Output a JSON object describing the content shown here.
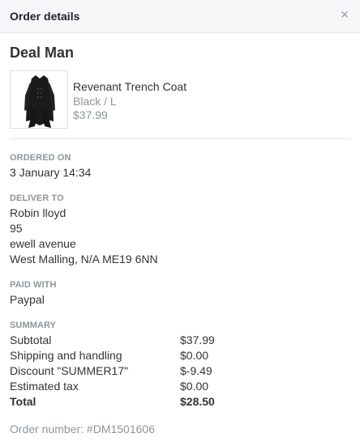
{
  "header": {
    "title": "Order details",
    "close_glyph": "×"
  },
  "merchant": "Deal Man",
  "product": {
    "name": "Revenant Trench Coat",
    "variant": "Black / L",
    "price": "$37.99",
    "image_icon": "trench-coat-image"
  },
  "ordered_on": {
    "label": "ORDERED ON",
    "value": "3 January 14:34"
  },
  "deliver_to": {
    "label": "DELIVER TO",
    "lines": [
      "Robin lloyd",
      "95",
      "ewell avenue",
      "West Malling, N/A ME19 6NN"
    ]
  },
  "paid_with": {
    "label": "PAID WITH",
    "value": "Paypal"
  },
  "summary": {
    "label": "SUMMARY",
    "rows": [
      {
        "label": "Subtotal",
        "value": "$37.99"
      },
      {
        "label": "Shipping and handling",
        "value": "$0.00"
      },
      {
        "label": "Discount \"SUMMER17\"",
        "value": "$-9.49"
      },
      {
        "label": "Estimated tax",
        "value": "$0.00"
      },
      {
        "label": "Total",
        "value": "$28.50"
      }
    ]
  },
  "order_number": "Order number: #DM1501606"
}
